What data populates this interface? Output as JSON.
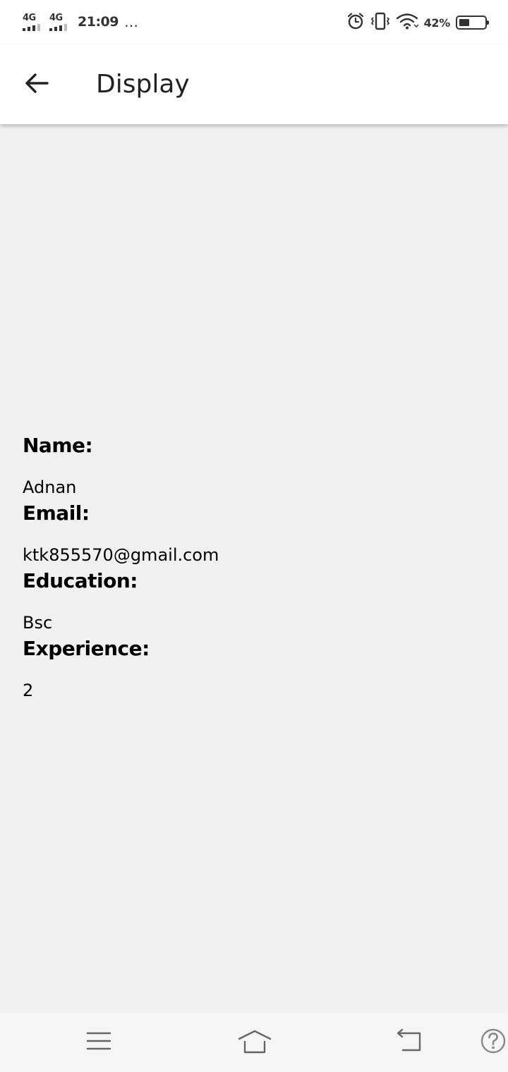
{
  "status_bar": {
    "network_1": "4G",
    "network_2": "4G",
    "time": "21:09",
    "overflow": "…",
    "battery_percent": "42%",
    "battery_level": 0.42,
    "icons": [
      "signal-icon",
      "alarm-icon",
      "vibrate-icon",
      "wifi-icon",
      "battery-icon"
    ]
  },
  "app_bar": {
    "back_icon": "arrow-left-icon",
    "title": "Display"
  },
  "details": {
    "name_label": "Name:",
    "name_value": "Adnan",
    "email_label": "Email:",
    "email_value": "ktk855570@gmail.com",
    "education_label": "Education:",
    "education_value": "Bsc",
    "experience_label": "Experience:",
    "experience_value": "2"
  },
  "nav_bar": {
    "icons": [
      "menu-icon",
      "home-icon",
      "back-icon",
      "help-icon"
    ]
  }
}
